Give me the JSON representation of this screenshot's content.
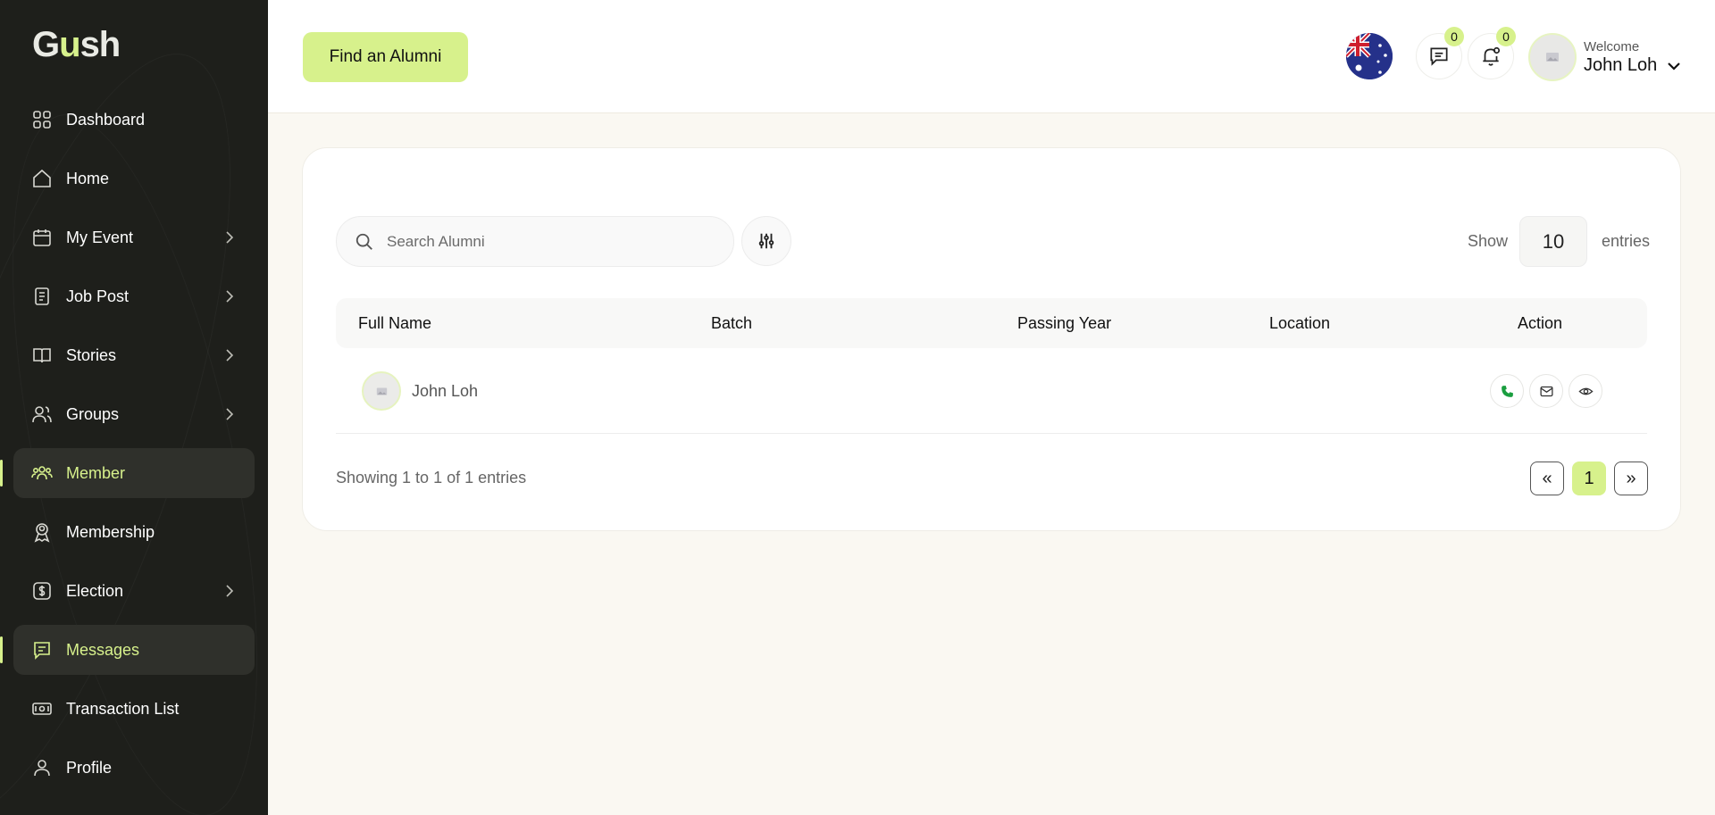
{
  "brand": {
    "logo_prefix": "G",
    "logo_accent": "u",
    "logo_suffix": "sh"
  },
  "sidebar": {
    "items": [
      {
        "label": "Dashboard",
        "icon": "dashboard-icon",
        "has_submenu": false,
        "active": false
      },
      {
        "label": "Home",
        "icon": "home-icon",
        "has_submenu": false,
        "active": false
      },
      {
        "label": "My Event",
        "icon": "calendar-icon",
        "has_submenu": true,
        "active": false
      },
      {
        "label": "Job Post",
        "icon": "document-icon",
        "has_submenu": true,
        "active": false
      },
      {
        "label": "Stories",
        "icon": "book-icon",
        "has_submenu": true,
        "active": false
      },
      {
        "label": "Groups",
        "icon": "users-icon",
        "has_submenu": true,
        "active": false
      },
      {
        "label": "Member",
        "icon": "members-icon",
        "has_submenu": false,
        "active": true
      },
      {
        "label": "Membership",
        "icon": "membership-icon",
        "has_submenu": false,
        "active": false
      },
      {
        "label": "Election",
        "icon": "dollar-icon",
        "has_submenu": true,
        "active": false
      },
      {
        "label": "Messages",
        "icon": "message-icon",
        "has_submenu": false,
        "active": true
      },
      {
        "label": "Transaction List",
        "icon": "cash-icon",
        "has_submenu": false,
        "active": false
      },
      {
        "label": "Profile",
        "icon": "user-icon",
        "has_submenu": false,
        "active": false
      }
    ]
  },
  "header": {
    "find_button": "Find an Alumni",
    "messages_count": "0",
    "notifications_count": "0",
    "welcome": "Welcome",
    "user_name": "John Loh"
  },
  "toolbar": {
    "search_placeholder": "Search Alumni",
    "show_label": "Show",
    "page_size": "10",
    "entries_label": "entries"
  },
  "table": {
    "columns": [
      "Full Name",
      "Batch",
      "Passing Year",
      "Location",
      "Action"
    ],
    "rows": [
      {
        "full_name": "John Loh",
        "batch": "",
        "passing_year": "",
        "location": ""
      }
    ]
  },
  "footer": {
    "showing_text": "Showing 1 to 1 of 1 entries",
    "prev_label": "«",
    "current_page": "1",
    "next_label": "»"
  },
  "colors": {
    "accent": "#d7f18c",
    "sidebar_bg": "#1e1f1b",
    "page_bg": "#faf8f2",
    "phone_green": "#1a9e3f"
  }
}
